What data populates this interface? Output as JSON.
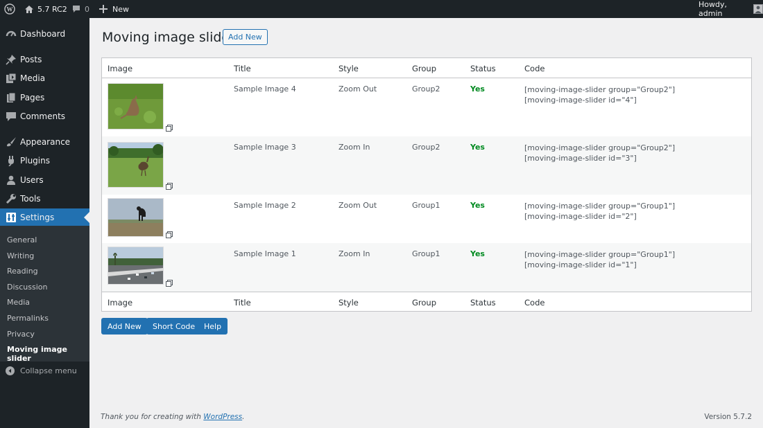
{
  "admin_bar": {
    "site_name": "5.7 RC2",
    "comments_count": "0",
    "new_label": "New",
    "howdy": "Howdy, admin"
  },
  "sidebar": {
    "items": [
      {
        "label": "Dashboard",
        "icon": "dashboard-icon"
      },
      {
        "label": "Posts",
        "icon": "pin-icon"
      },
      {
        "label": "Media",
        "icon": "media-icon"
      },
      {
        "label": "Pages",
        "icon": "pages-icon"
      },
      {
        "label": "Comments",
        "icon": "comments-icon"
      },
      {
        "label": "Appearance",
        "icon": "brush-icon"
      },
      {
        "label": "Plugins",
        "icon": "plugin-icon"
      },
      {
        "label": "Users",
        "icon": "user-icon"
      },
      {
        "label": "Tools",
        "icon": "wrench-icon"
      },
      {
        "label": "Settings",
        "icon": "settings-icon"
      }
    ],
    "submenu": [
      "General",
      "Writing",
      "Reading",
      "Discussion",
      "Media",
      "Permalinks",
      "Privacy",
      "Moving image slider"
    ],
    "collapse_label": "Collapse menu"
  },
  "page": {
    "title": "Moving image slider",
    "add_new": "Add New"
  },
  "table": {
    "columns": [
      "Image",
      "Title",
      "Style",
      "Group",
      "Status",
      "Code"
    ],
    "rows": [
      {
        "title": "Sample Image 4",
        "style": "Zoom Out",
        "group": "Group2",
        "status": "Yes",
        "code1": "[moving-image-slider group=\"Group2\"]",
        "code2": "[moving-image-slider id=\"4\"]",
        "thumb": "kangaroo-photo"
      },
      {
        "title": "Sample Image 3",
        "style": "Zoom In",
        "group": "Group2",
        "status": "Yes",
        "code1": "[moving-image-slider group=\"Group2\"]",
        "code2": "[moving-image-slider id=\"3\"]",
        "thumb": "emu-photo"
      },
      {
        "title": "Sample Image 2",
        "style": "Zoom Out",
        "group": "Group1",
        "status": "Yes",
        "code1": "[moving-image-slider group=\"Group1\"]",
        "code2": "[moving-image-slider id=\"2\"]",
        "thumb": "cow-photo"
      },
      {
        "title": "Sample Image 1",
        "style": "Zoom In",
        "group": "Group1",
        "status": "Yes",
        "code1": "[moving-image-slider group=\"Group1\"]",
        "code2": "[moving-image-slider id=\"1\"]",
        "thumb": "highway-photo"
      }
    ]
  },
  "buttons": {
    "add_new": "Add New",
    "short_code": "Short Code",
    "help": "Help"
  },
  "footer": {
    "thanks_prefix": "Thank you for creating with ",
    "thanks_link": "WordPress",
    "thanks_suffix": ".",
    "version": "Version 5.7.2"
  },
  "colors": {
    "admin_dark": "#1d2327",
    "accent": "#2271b1",
    "status_yes": "#008a20"
  }
}
